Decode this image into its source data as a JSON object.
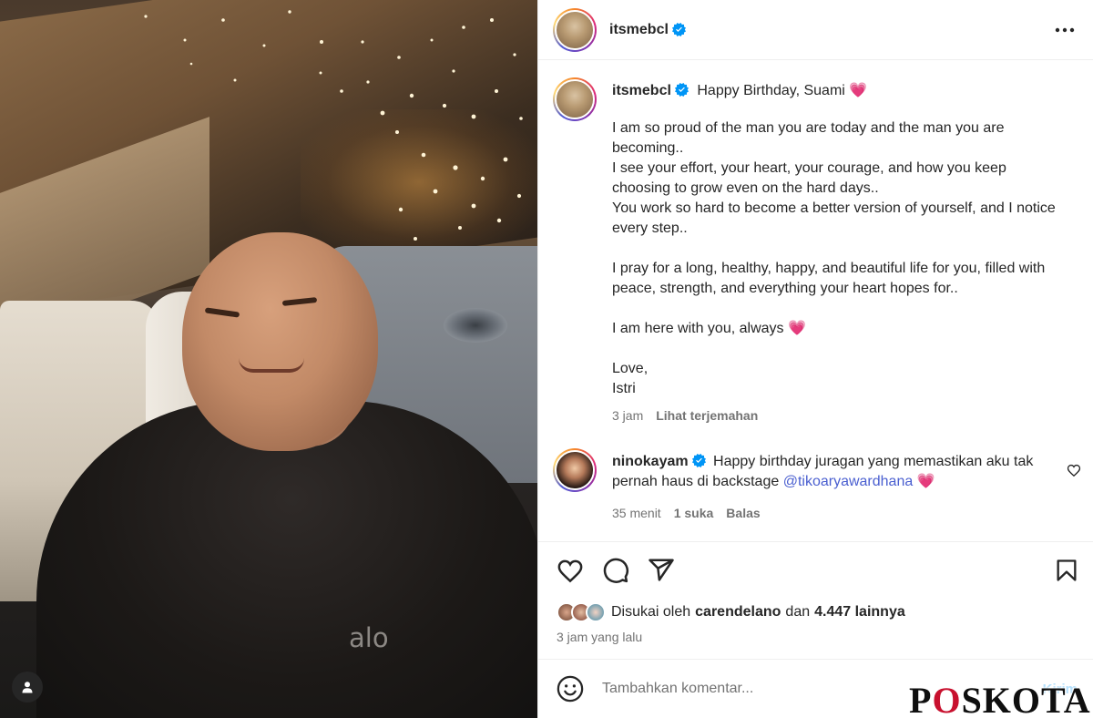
{
  "post": {
    "username": "itsmebcl",
    "more_label": "…"
  },
  "caption": {
    "title": "Happy Birthday, Suami",
    "emoji": "💗",
    "body": "I am so proud of the man you are today and the man you are becoming..\nI see your effort, your heart, your courage, and how you keep choosing to grow even on the hard days..\nYou work so hard to become a better version of yourself, and I notice every step..\n\nI pray for a long, healthy, happy, and beautiful life for you, filled with peace, strength, and everything your heart hopes for..\n\nI am here with you, always 💗\n\nLove,\nIstri",
    "time": "3 jam",
    "translate_label": "Lihat terjemahan"
  },
  "comment": {
    "username": "ninokayam",
    "text": "Happy birthday juragan yang memastikan aku tak pernah haus di backstage",
    "mention": "@tikoaryawardhana",
    "emoji": "💗",
    "time": "35 menit",
    "likes": "1 suka",
    "reply_label": "Balas"
  },
  "likes": {
    "prefix": "Disukai oleh",
    "first_liker": "carendelano",
    "conj": "dan",
    "others": "4.447 lainnya"
  },
  "timestamp": "3 jam yang lalu",
  "comment_box": {
    "placeholder": "Tambahkan komentar...",
    "send_label": "Kirim"
  },
  "photo": {
    "shirt_logo": "alo"
  },
  "watermark": {
    "part1": "P",
    "part2": "O",
    "part3": "SKOTA"
  },
  "colors": {
    "verified": "#0095f6",
    "mention": "#4a5fd0",
    "heart": "#e8326c"
  },
  "icons": [
    "tag-user-icon",
    "verified-icon",
    "more-icon",
    "heart-icon",
    "comment-icon",
    "share-icon",
    "save-icon",
    "emoji-icon"
  ]
}
